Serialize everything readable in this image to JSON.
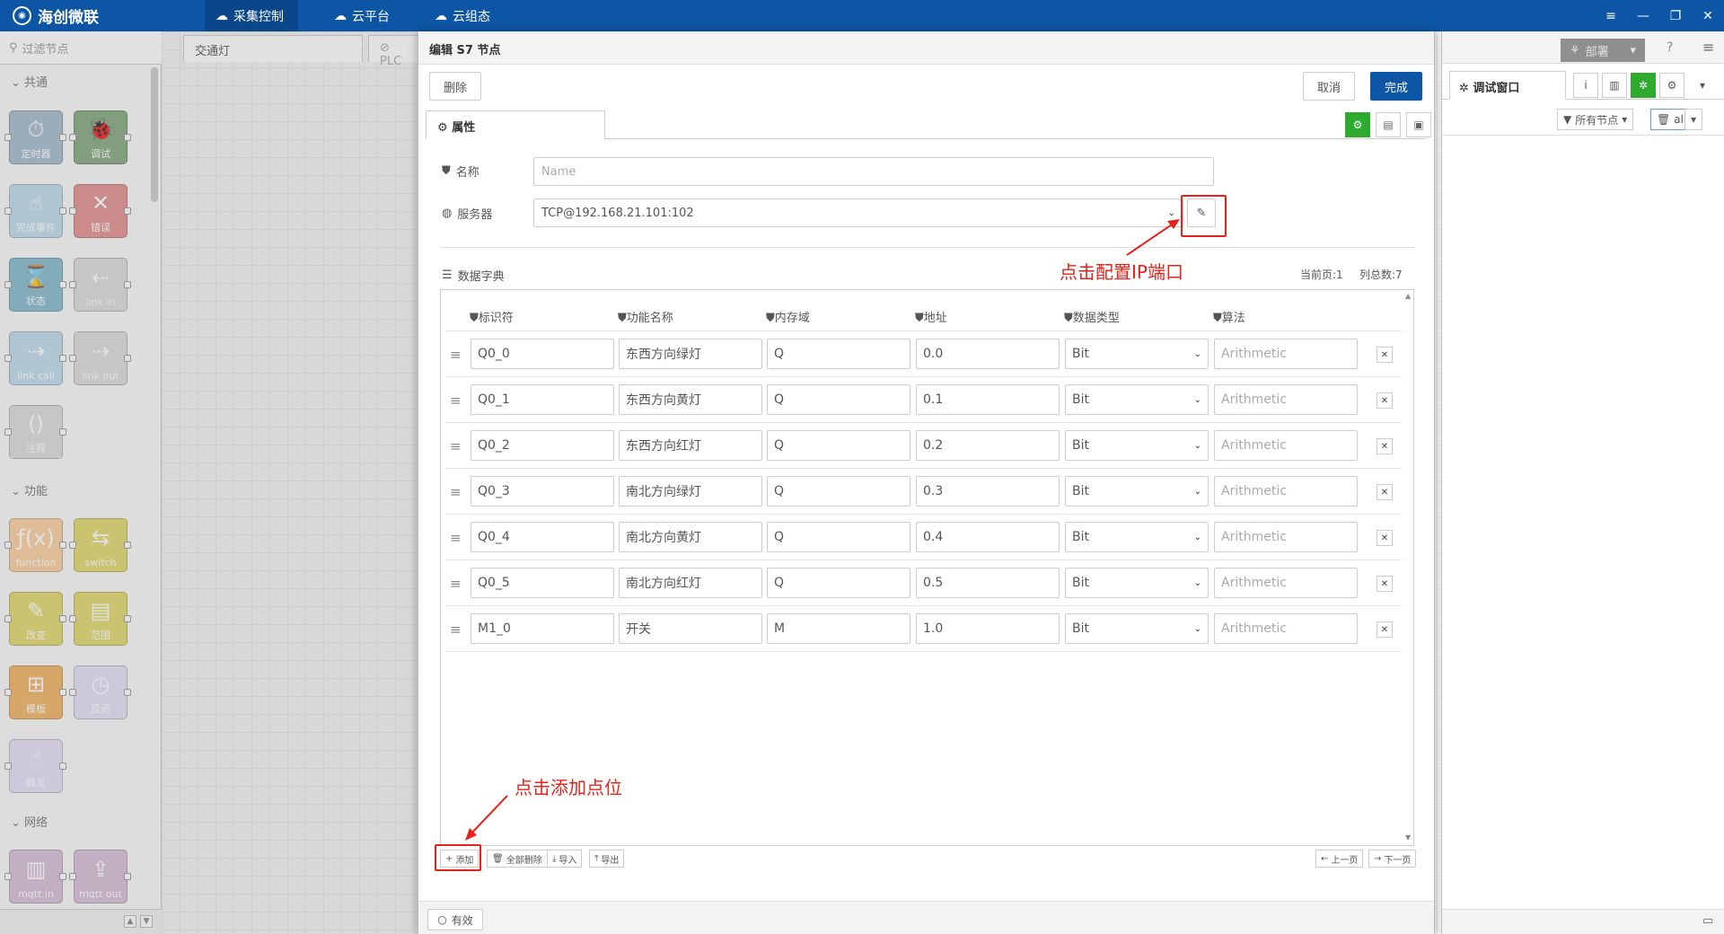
{
  "topbar": {
    "app_name": "海创微联",
    "nav": [
      {
        "label": "采集控制",
        "active": true
      },
      {
        "label": "云平台",
        "active": false
      },
      {
        "label": "云组态",
        "active": false
      }
    ],
    "window_controls": [
      "≡",
      "—",
      "❐",
      "✕"
    ]
  },
  "palette": {
    "filter_placeholder": "过滤节点",
    "categories": [
      "共通",
      "功能",
      "网络"
    ],
    "nodes": [
      {
        "label": "定时器",
        "icon": "⏱",
        "color": "#a6bbcf"
      },
      {
        "label": "调试",
        "icon": "🐞",
        "color": "#87a980"
      },
      {
        "label": "完成事件",
        "icon": "☝",
        "color": "#c0deed"
      },
      {
        "label": "错误",
        "icon": "✕",
        "color": "#e49191"
      },
      {
        "label": "状态",
        "icon": "⌛",
        "color": "#87bccf"
      },
      {
        "label": "link in",
        "icon": "⇠",
        "color": "#dddddd"
      },
      {
        "label": "link call",
        "icon": "⇢",
        "color": "#c0deed"
      },
      {
        "label": "link out",
        "icon": "⇢",
        "color": "#dddddd"
      },
      {
        "label": "注释",
        "icon": "⟨⟩",
        "color": "#dddddd"
      },
      {
        "label": "function",
        "icon": "ƒ(x)",
        "color": "#fdd0a2"
      },
      {
        "label": "switch",
        "icon": "⇆",
        "color": "#e2d96e"
      },
      {
        "label": "改变",
        "icon": "✎",
        "color": "#e2d96e"
      },
      {
        "label": "范围",
        "icon": "▤",
        "color": "#e2d96e"
      },
      {
        "label": "模板",
        "icon": "⊞",
        "color": "#f3b567"
      },
      {
        "label": "延迟",
        "icon": "◷",
        "color": "#e6e0f8"
      },
      {
        "label": "触发",
        "icon": "☝",
        "color": "#e6e0f8"
      },
      {
        "label": "mqtt in",
        "icon": "▥",
        "color": "#d8bfd8"
      },
      {
        "label": "mqtt out",
        "icon": "⇪",
        "color": "#d8bfd8"
      }
    ]
  },
  "workspace": {
    "tabs": [
      "交通灯",
      "PLC"
    ]
  },
  "editor": {
    "title": "编辑 S7 节点",
    "delete_label": "删除",
    "cancel_label": "取消",
    "done_label": "完成",
    "properties_tab": "属性",
    "name_label": "名称",
    "name_placeholder": "Name",
    "server_label": "服务器",
    "server_value": "TCP@192.168.21.101:102",
    "dict_label": "数据字典",
    "current_page": "当前页:1",
    "column_count": "列总数:7",
    "columns": [
      "标识符",
      "功能名称",
      "内存域",
      "地址",
      "数据类型",
      "算法"
    ],
    "rows": [
      {
        "id": "Q0_0",
        "name": "东西方向绿灯",
        "area": "Q",
        "addr": "0.0",
        "type": "Bit",
        "algo": "Arithmetic"
      },
      {
        "id": "Q0_1",
        "name": "东西方向黄灯",
        "area": "Q",
        "addr": "0.1",
        "type": "Bit",
        "algo": "Arithmetic"
      },
      {
        "id": "Q0_2",
        "name": "东西方向红灯",
        "area": "Q",
        "addr": "0.2",
        "type": "Bit",
        "algo": "Arithmetic"
      },
      {
        "id": "Q0_3",
        "name": "南北方向绿灯",
        "area": "Q",
        "addr": "0.3",
        "type": "Bit",
        "algo": "Arithmetic"
      },
      {
        "id": "Q0_4",
        "name": "南北方向黄灯",
        "area": "Q",
        "addr": "0.4",
        "type": "Bit",
        "algo": "Arithmetic"
      },
      {
        "id": "Q0_5",
        "name": "南北方向红灯",
        "area": "Q",
        "addr": "0.5",
        "type": "Bit",
        "algo": "Arithmetic"
      },
      {
        "id": "M1_0",
        "name": "开关",
        "area": "M",
        "addr": "1.0",
        "type": "Bit",
        "algo": "Arithmetic"
      }
    ],
    "add_label": "添加",
    "delete_all_label": "全部删除",
    "import_label": "导入",
    "export_label": "导出",
    "prev_label": "上一页",
    "next_label": "下一页",
    "valid_label": "有效"
  },
  "annotations": {
    "config_ip": "点击配置IP端口",
    "add_point": "点击添加点位"
  },
  "sidebar": {
    "deploy_label": "部署",
    "debug_tab": "调试窗口",
    "all_nodes_label": "所有节点",
    "all_label": "all"
  },
  "colors": {
    "brand": "#0d56a6",
    "annotation": "#e8211a",
    "settings_active": "#2eaa2e"
  }
}
